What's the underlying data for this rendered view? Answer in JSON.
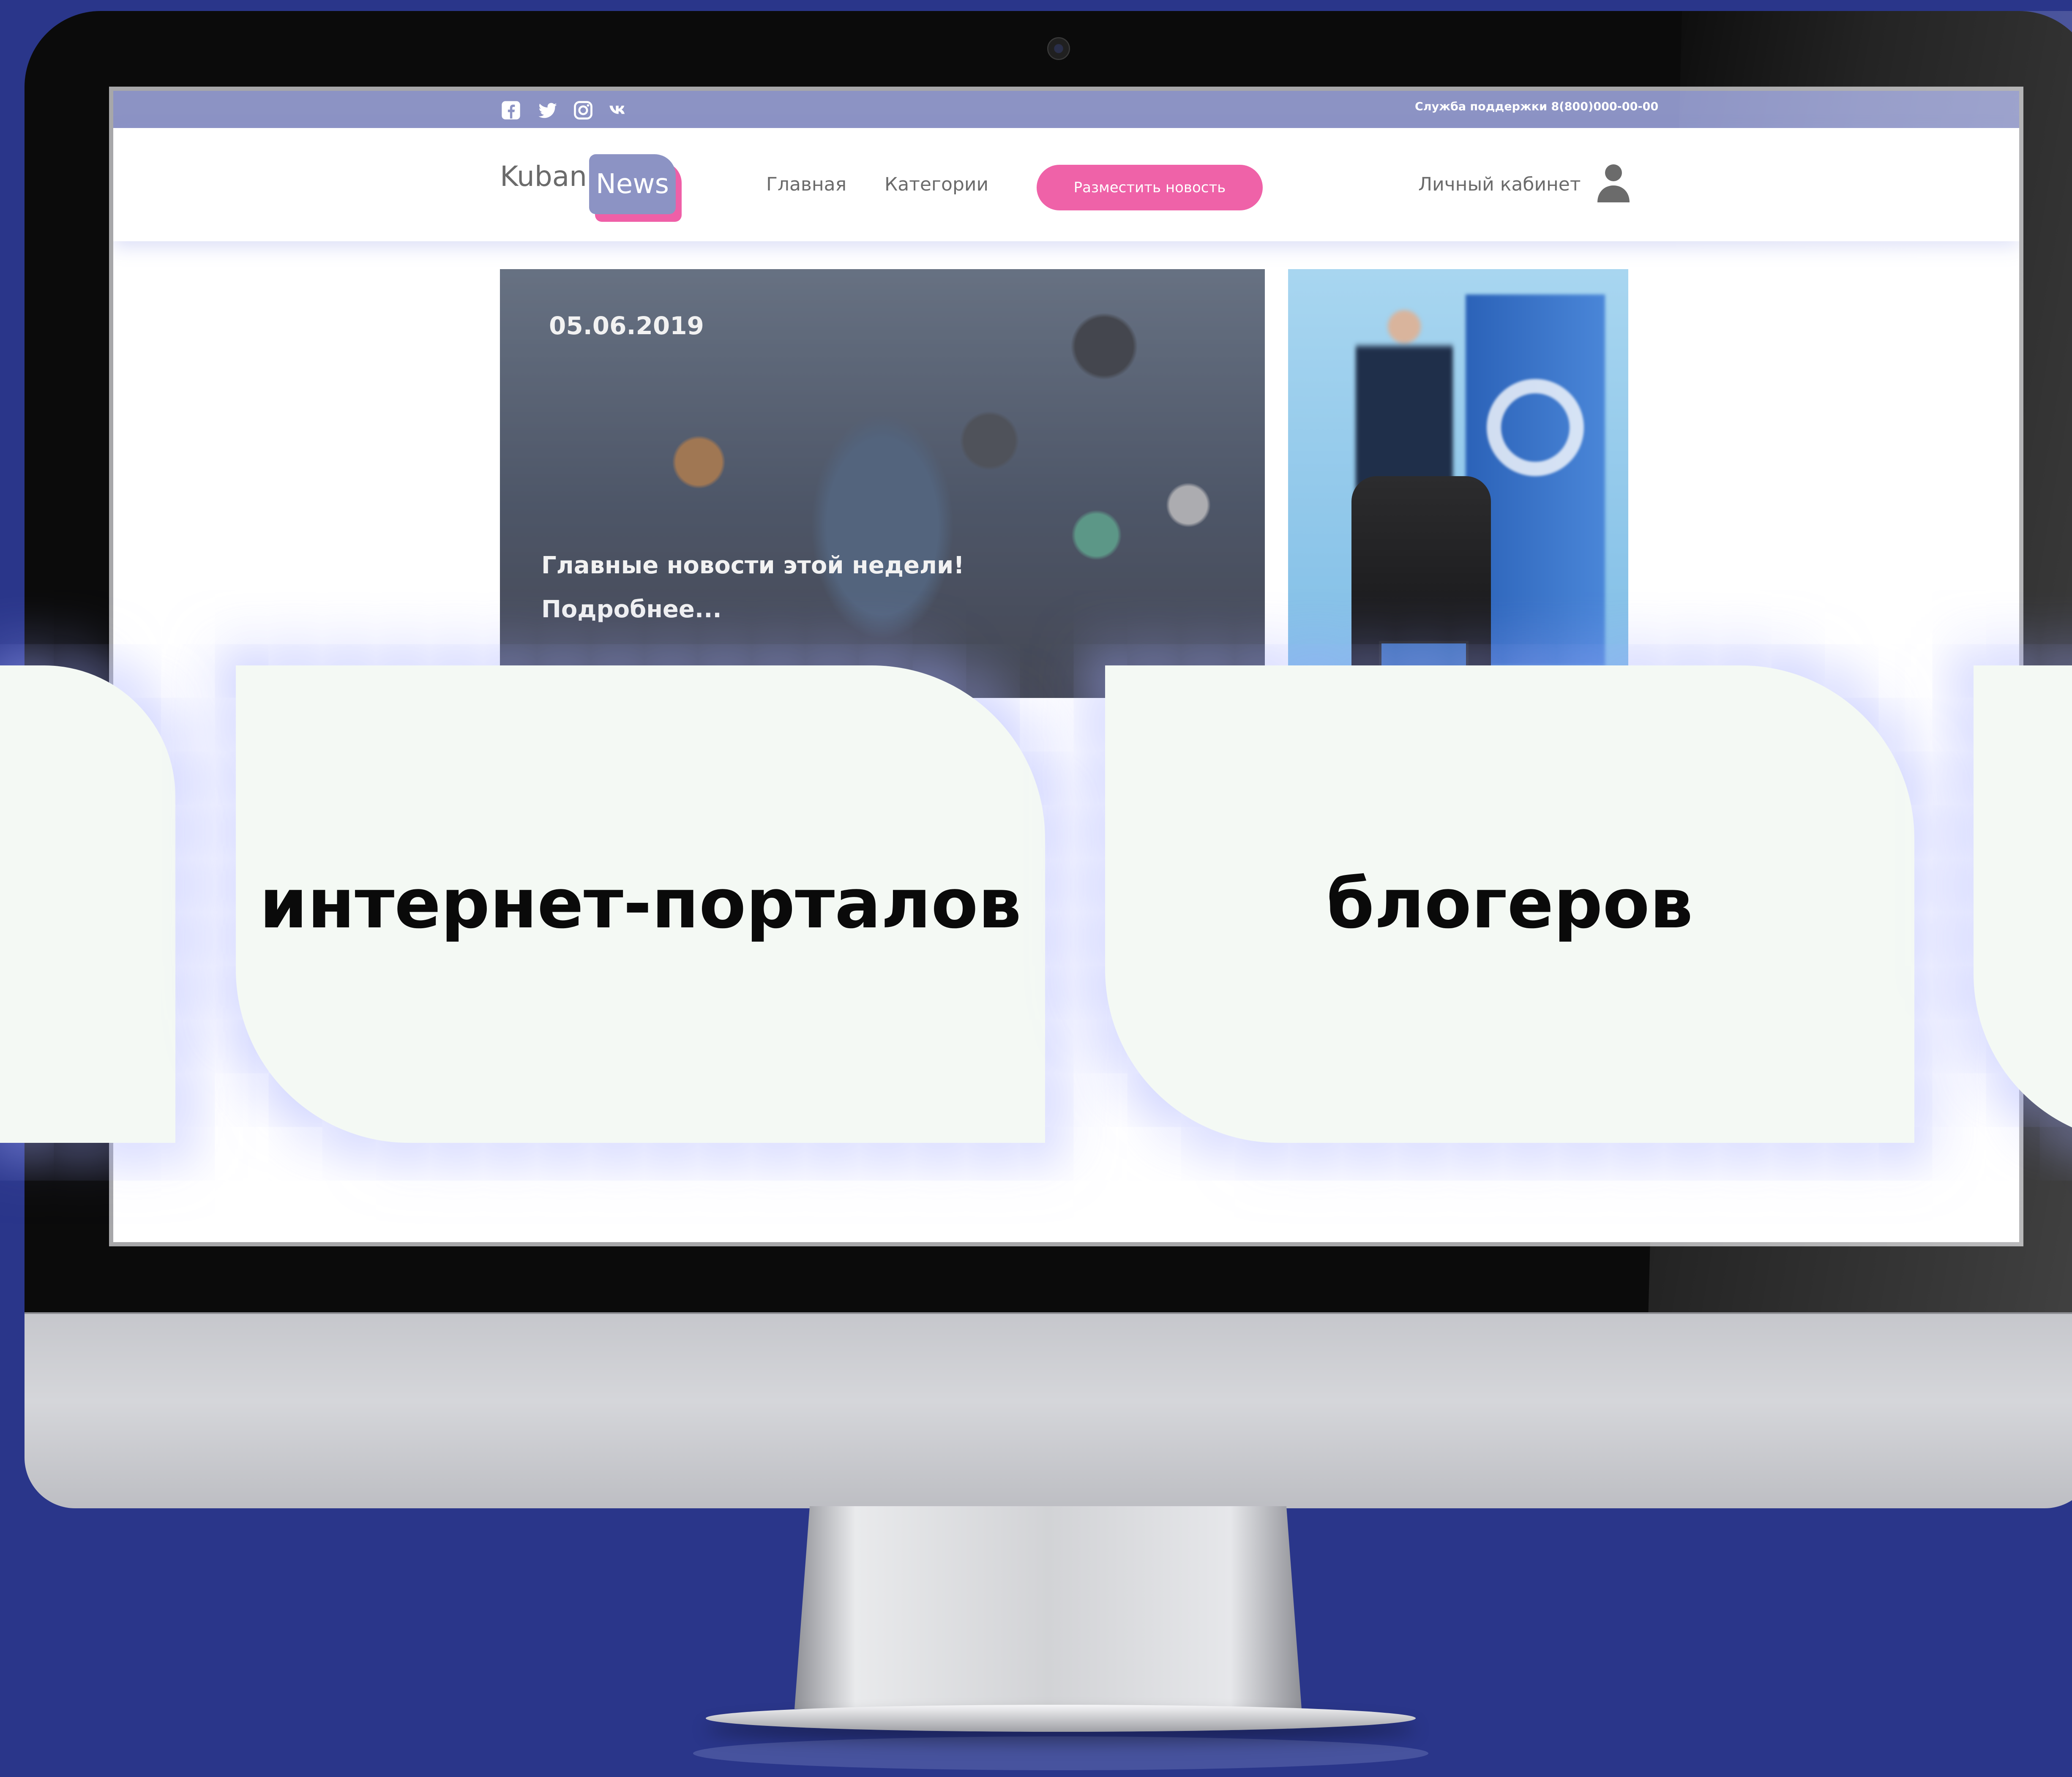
{
  "site": {
    "logo_part1": "Kuban",
    "logo_part2": "News",
    "support_text": "Служба поддержки 8(800)000-00-00",
    "social_icons": [
      "facebook-icon",
      "twitter-icon",
      "instagram-icon",
      "vk-icon"
    ]
  },
  "nav": {
    "home": "Главная",
    "categories": "Категории",
    "post_news_button": "Разместить новость",
    "account": "Личный кабинет",
    "account_icon": "user-icon"
  },
  "hero": {
    "date": "05.06.2019",
    "headline": "Главные новости этой недели!",
    "more": "Подробнее..."
  },
  "cards": {
    "card_1": "интернет-порталов",
    "card_2": "блогеров"
  },
  "colors": {
    "background": "#2a368a",
    "topbar": "#8c93c4",
    "accent_pink": "#ef62a8",
    "card_bg": "#f4f9f4"
  }
}
